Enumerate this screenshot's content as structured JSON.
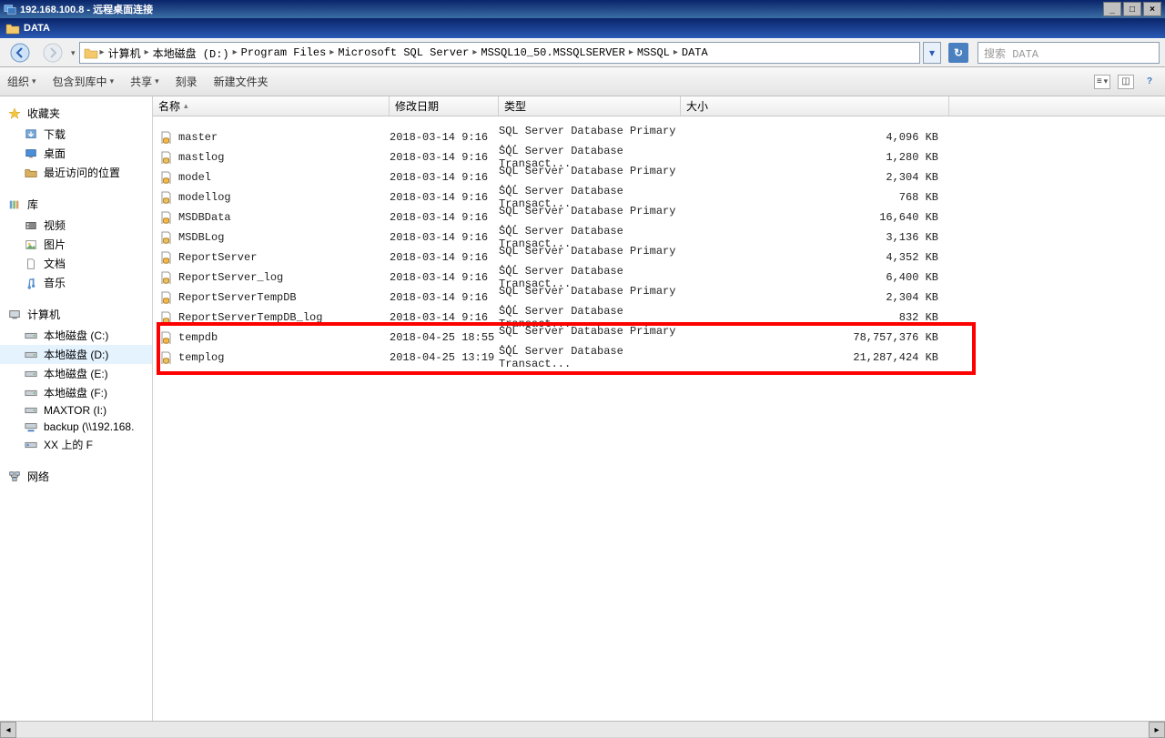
{
  "rdp": {
    "title": "192.168.100.8 - 远程桌面连接"
  },
  "explorer": {
    "title": "DATA"
  },
  "breadcrumb": {
    "parts": [
      "计算机",
      "本地磁盘 (D:)",
      "Program Files",
      "Microsoft SQL Server",
      "MSSQL10_50.MSSQLSERVER",
      "MSSQL",
      "DATA"
    ]
  },
  "search": {
    "placeholder": "搜索 DATA"
  },
  "toolbar": {
    "organize": "组织",
    "include": "包含到库中",
    "share": "共享",
    "burn": "刻录",
    "newfolder": "新建文件夹"
  },
  "columns": {
    "name": "名称",
    "date": "修改日期",
    "type": "类型",
    "size": "大小"
  },
  "sidebar": {
    "favorites": "收藏夹",
    "fav_items": {
      "downloads": "下载",
      "desktop": "桌面",
      "recent": "最近访问的位置"
    },
    "libraries": "库",
    "lib_items": {
      "videos": "视频",
      "pictures": "图片",
      "documents": "文档",
      "music": "音乐"
    },
    "computer": "计算机",
    "drives": {
      "c": "本地磁盘 (C:)",
      "d": "本地磁盘 (D:)",
      "e": "本地磁盘 (E:)",
      "f": "本地磁盘 (F:)",
      "i": "MAXTOR (I:)",
      "backup": "backup (\\\\192.168.",
      "xx": "XX 上的 F"
    },
    "network": "网络"
  },
  "files": [
    {
      "name": "master",
      "date": "2018-03-14 9:16",
      "type": "SQL Server Database Primary ...",
      "size": "4,096 KB",
      "icon": "mdf"
    },
    {
      "name": "mastlog",
      "date": "2018-03-14 9:16",
      "type": "SQL Server Database Transact...",
      "size": "1,280 KB",
      "icon": "ldf"
    },
    {
      "name": "model",
      "date": "2018-03-14 9:16",
      "type": "SQL Server Database Primary ...",
      "size": "2,304 KB",
      "icon": "mdf"
    },
    {
      "name": "modellog",
      "date": "2018-03-14 9:16",
      "type": "SQL Server Database Transact...",
      "size": "768 KB",
      "icon": "ldf"
    },
    {
      "name": "MSDBData",
      "date": "2018-03-14 9:16",
      "type": "SQL Server Database Primary ...",
      "size": "16,640 KB",
      "icon": "mdf"
    },
    {
      "name": "MSDBLog",
      "date": "2018-03-14 9:16",
      "type": "SQL Server Database Transact...",
      "size": "3,136 KB",
      "icon": "ldf"
    },
    {
      "name": "ReportServer",
      "date": "2018-03-14 9:16",
      "type": "SQL Server Database Primary ...",
      "size": "4,352 KB",
      "icon": "mdf"
    },
    {
      "name": "ReportServer_log",
      "date": "2018-03-14 9:16",
      "type": "SQL Server Database Transact...",
      "size": "6,400 KB",
      "icon": "ldf"
    },
    {
      "name": "ReportServerTempDB",
      "date": "2018-03-14 9:16",
      "type": "SQL Server Database Primary ...",
      "size": "2,304 KB",
      "icon": "mdf"
    },
    {
      "name": "ReportServerTempDB_log",
      "date": "2018-03-14 9:16",
      "type": "SQL Server Database Transact...",
      "size": "832 KB",
      "icon": "ldf"
    },
    {
      "name": "tempdb",
      "date": "2018-04-25 18:55",
      "type": "SQL Server Database Primary ...",
      "size": "78,757,376 KB",
      "icon": "mdf"
    },
    {
      "name": "templog",
      "date": "2018-04-25 13:19",
      "type": "SQL Server Database Transact...",
      "size": "21,287,424 KB",
      "icon": "ldf"
    }
  ]
}
